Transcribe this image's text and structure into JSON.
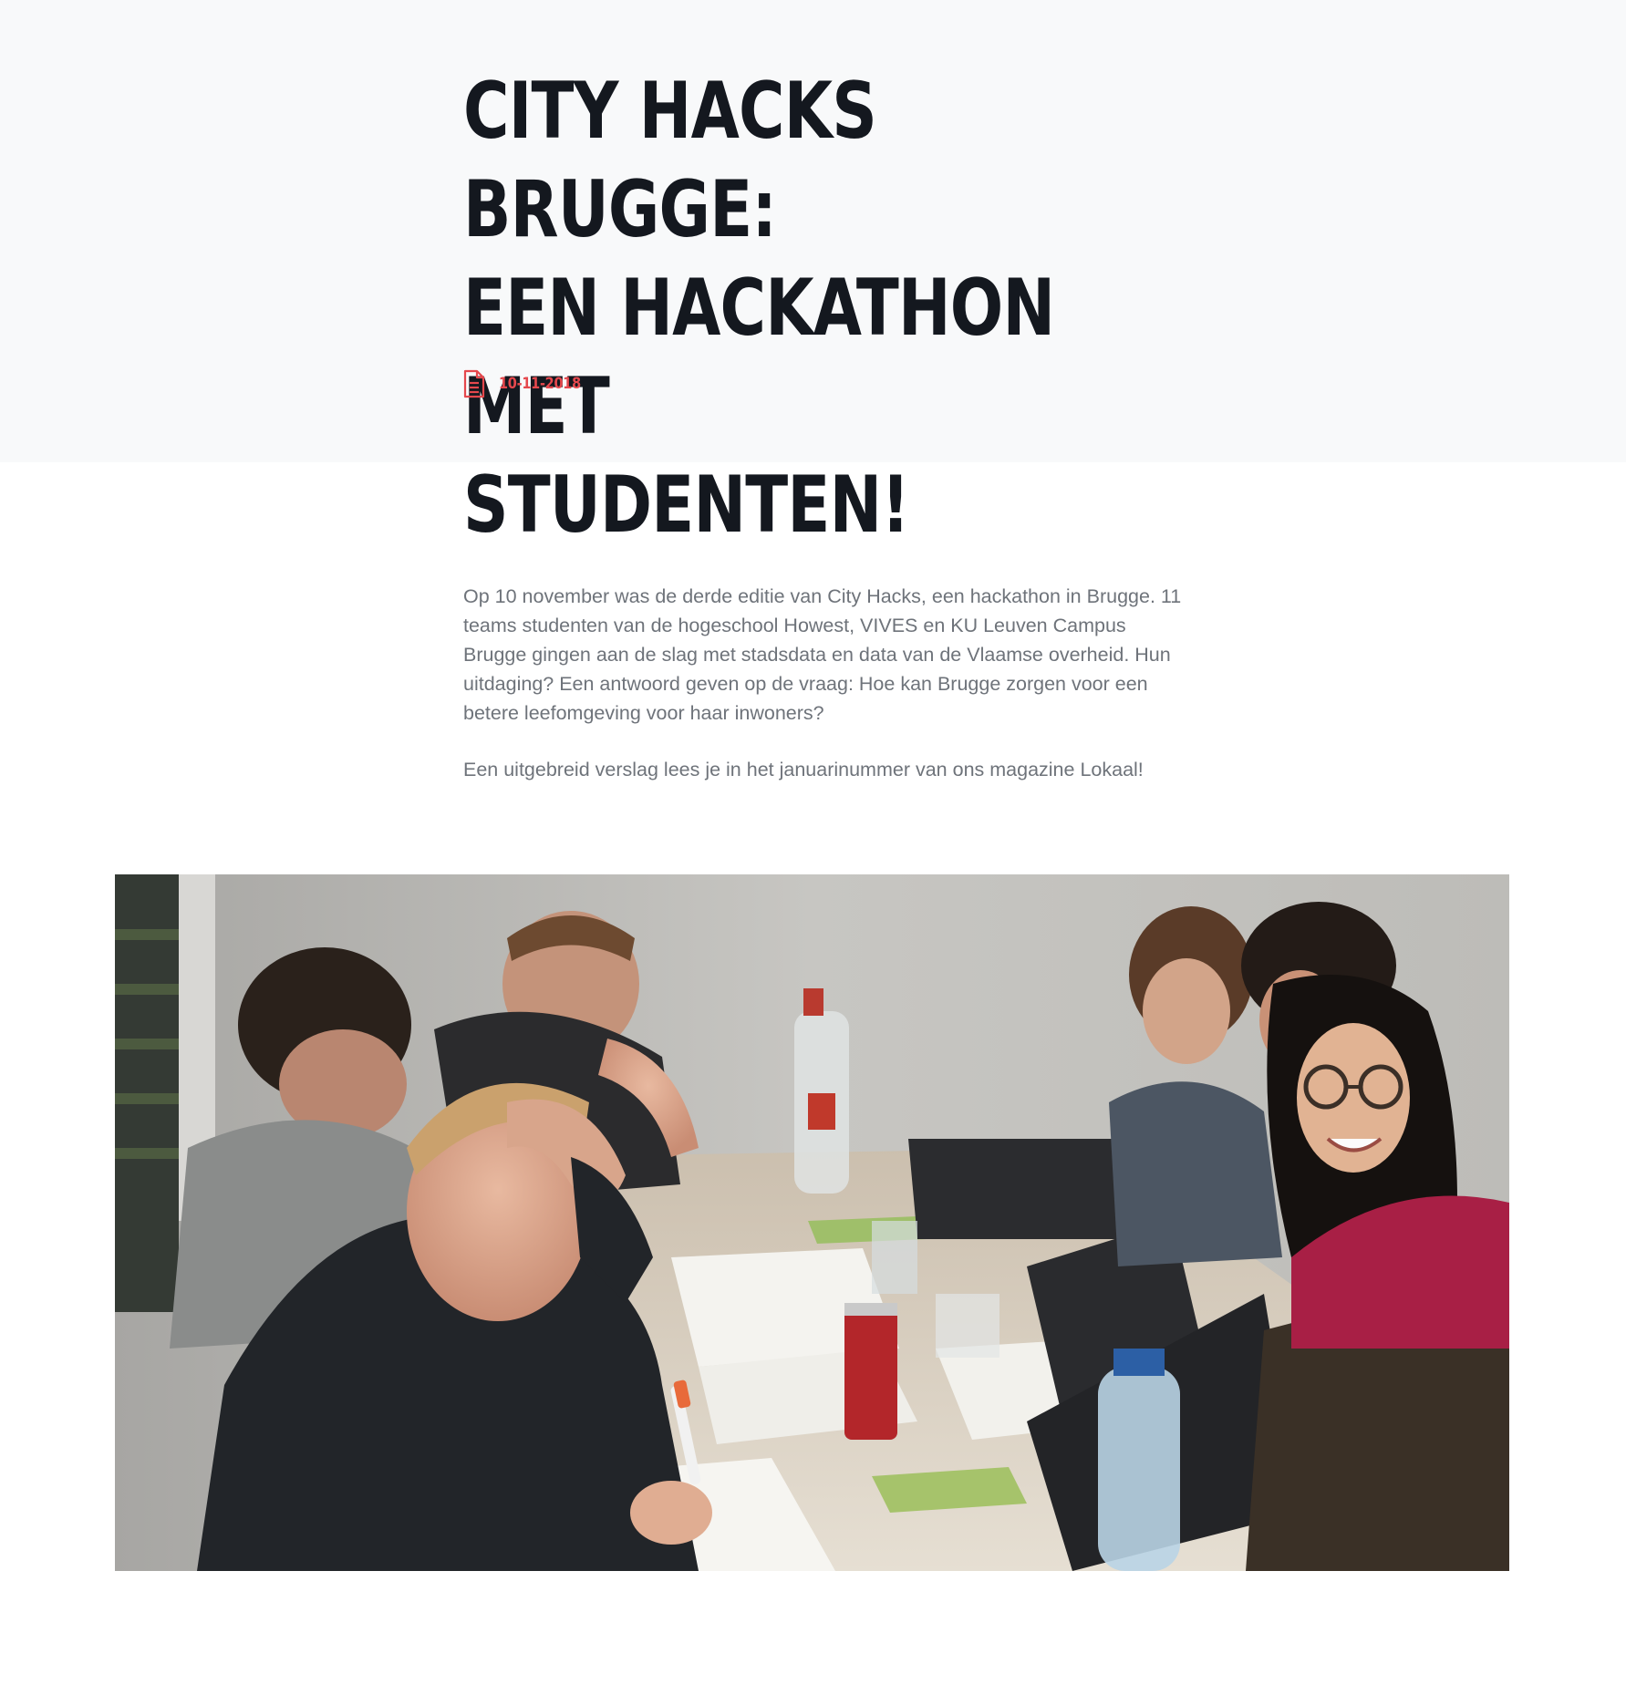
{
  "article": {
    "title": "CITY HACKS BRUGGE: EEN HACKATHON MET STUDENTEN!",
    "title_lines": [
      "CITY HACKS BRUGGE:",
      "EEN HACKATHON MET",
      "STUDENTEN!"
    ],
    "date": "10-11-2018",
    "date_icon": "document-icon",
    "paragraphs": [
      "Op 10 november was de derde editie van City Hacks, een hackathon in Brugge. 11 teams studenten van de hogeschool Howest, VIVES en KU Leuven Campus Brugge gingen aan de slag met stadsdata en data van de Vlaamse overheid. Hun uitdaging? Een antwoord geven op de vraag: Hoe kan Brugge zorgen voor een betere leefomgeving voor haar inwoners?",
      "Een uitgebreid verslag lees je in het januarinummer van ons magazine Lokaal!"
    ]
  },
  "colors": {
    "accent": "#e5484d",
    "title": "#14181f",
    "body_text": "#6e737a",
    "hero_background": "#f8f9fa"
  }
}
